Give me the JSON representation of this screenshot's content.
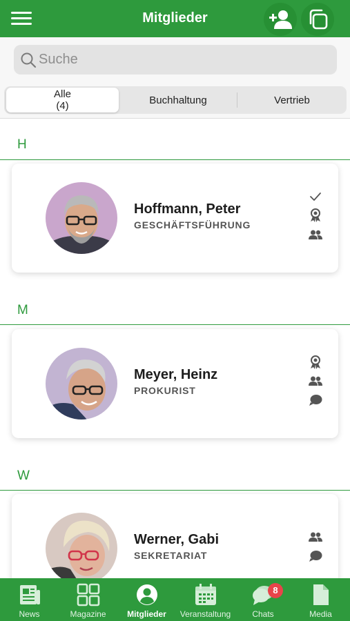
{
  "header": {
    "title": "Mitglieder",
    "menu_icon": "hamburger-menu-icon",
    "add_icon": "add-person-icon",
    "copy_icon": "copy-icon"
  },
  "search": {
    "placeholder": "Suche"
  },
  "segments": [
    {
      "label": "Alle",
      "count": "(4)",
      "selected": true
    },
    {
      "label": "Buchhaltung",
      "selected": false
    },
    {
      "label": "Vertrieb",
      "selected": false
    }
  ],
  "sections": [
    {
      "letter": "H",
      "members": [
        {
          "name": "Hoffmann, Peter",
          "role": "GESCHÄFTSFÜHRUNG",
          "icons": [
            "checkmark-icon",
            "award-icon",
            "group-icon"
          ]
        }
      ]
    },
    {
      "letter": "M",
      "members": [
        {
          "name": "Meyer, Heinz",
          "role": "PROKURIST",
          "icons": [
            "award-icon",
            "group-icon",
            "chat-bubble-icon"
          ]
        }
      ]
    },
    {
      "letter": "W",
      "members": [
        {
          "name": "Werner, Gabi",
          "role": "SEKRETARIAT",
          "icons": [
            "group-icon",
            "chat-bubble-icon"
          ]
        }
      ]
    }
  ],
  "bottom_nav": [
    {
      "label": "News",
      "icon": "newspaper-icon",
      "active": false
    },
    {
      "label": "Magazine",
      "icon": "grid-icon",
      "active": false
    },
    {
      "label": "Mitglieder",
      "icon": "user-circle-icon",
      "active": true
    },
    {
      "label": "Veranstaltung",
      "icon": "calendar-icon",
      "active": false
    },
    {
      "label": "Chats",
      "icon": "chat-icon",
      "active": false,
      "badge": "8"
    },
    {
      "label": "Media",
      "icon": "document-icon",
      "active": false
    }
  ],
  "colors": {
    "brand_green": "#2e9a3d",
    "badge_red": "#e8444a"
  }
}
